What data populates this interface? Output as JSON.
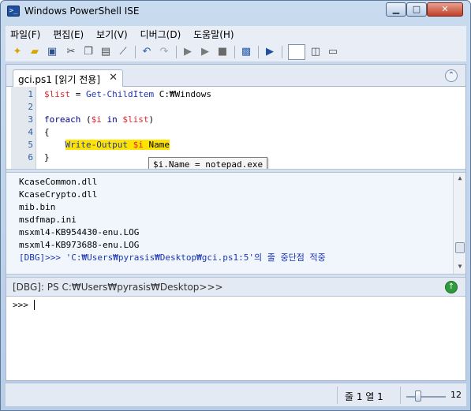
{
  "window": {
    "title": "Windows PowerShell ISE",
    "icon": "powershell-icon"
  },
  "menu": [
    "파일(F)",
    "편집(E)",
    "보기(V)",
    "디버그(D)",
    "도움말(H)"
  ],
  "toolbar": {
    "icons": [
      "new-file-icon",
      "open-folder-icon",
      "save-icon",
      "cut-icon",
      "copy-icon",
      "paste-icon",
      "clear-icon",
      "undo-icon",
      "redo-icon",
      "run-icon",
      "run-selection-icon",
      "stop-icon",
      "remote-icon",
      "powershell-icon",
      "layout-top-icon",
      "layout-right-icon",
      "layout-max-icon"
    ]
  },
  "tab": {
    "label": "gci.ps1 [읽기 전용]",
    "close": "✕"
  },
  "editor": {
    "lines": [
      {
        "n": "1",
        "html_parts": [
          [
            "var",
            "$list"
          ],
          [
            "plain",
            " = "
          ],
          [
            "cmd",
            "Get-ChildItem"
          ],
          [
            "plain",
            " C:₩Windows"
          ]
        ]
      },
      {
        "n": "2",
        "html_parts": []
      },
      {
        "n": "3",
        "html_parts": [
          [
            "kw",
            "foreach"
          ],
          [
            "plain",
            " ("
          ],
          [
            "var",
            "$i"
          ],
          [
            "kw",
            " in "
          ],
          [
            "var",
            "$list"
          ],
          [
            "plain",
            ")"
          ]
        ]
      },
      {
        "n": "4",
        "html_parts": [
          [
            "plain",
            "{"
          ]
        ]
      },
      {
        "n": "5",
        "html_parts": [
          [
            "plain",
            "    "
          ],
          [
            "hlcmd",
            "Write-Output"
          ],
          [
            "hlplain",
            " "
          ],
          [
            "hlvar",
            "$i"
          ],
          [
            "hlplain",
            " Name"
          ]
        ]
      },
      {
        "n": "6",
        "html_parts": [
          [
            "plain",
            "}"
          ]
        ]
      }
    ],
    "tooltip": "$i.Name = notepad.exe"
  },
  "output": {
    "lines": [
      "KcaseCommon.dll",
      "KcaseCrypto.dll",
      "mib.bin",
      "msdfmap.ini",
      "msxml4-KB954430-enu.LOG",
      "msxml4-KB973688-enu.LOG"
    ],
    "dbg_line": "[DBG]>>> 'C:₩Users₩pyrasis₩Desktop₩gci.ps1:5'의 줄 중단점 적중"
  },
  "prompt": {
    "text": "[DBG]: PS C:₩Users₩pyrasis₩Desktop>>>"
  },
  "command": {
    "prompt": ">>>",
    "value": ""
  },
  "status": {
    "position": "줄 1  열 1",
    "zoom": "12",
    "zoom_fraction": 0.25
  },
  "colors": {
    "variable": "#e0242e",
    "cmdlet": "#1c35b3",
    "keyword": "#00008b",
    "highlight": "#ffe300",
    "line_number": "#2b5fa4"
  }
}
